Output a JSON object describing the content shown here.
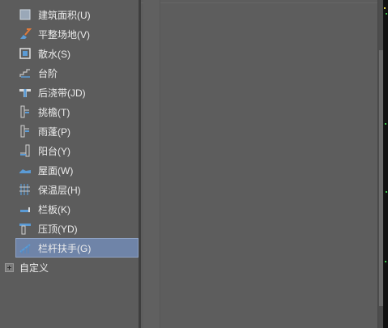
{
  "tree": {
    "items": [
      {
        "label": "建筑面积(U)",
        "icon": "building-area-icon"
      },
      {
        "label": "平整场地(V)",
        "icon": "site-leveling-icon"
      },
      {
        "label": "散水(S)",
        "icon": "apron-icon"
      },
      {
        "label": "台阶",
        "icon": "steps-icon"
      },
      {
        "label": "后浇带(JD)",
        "icon": "post-pour-strip-icon"
      },
      {
        "label": "挑檐(T)",
        "icon": "eave-icon"
      },
      {
        "label": "雨蓬(P)",
        "icon": "canopy-icon"
      },
      {
        "label": "阳台(Y)",
        "icon": "balcony-icon"
      },
      {
        "label": "屋面(W)",
        "icon": "roof-icon"
      },
      {
        "label": "保温层(H)",
        "icon": "insulation-icon"
      },
      {
        "label": "栏板(K)",
        "icon": "parapet-icon"
      },
      {
        "label": "压顶(YD)",
        "icon": "coping-icon"
      },
      {
        "label": "栏杆扶手(G)",
        "icon": "railing-icon"
      }
    ],
    "selected_label": "栏杆扶手(G)",
    "group_label": "自定义"
  },
  "colors": {
    "selection": "#6f84a8",
    "icon_blue": "#5b9bd5"
  }
}
